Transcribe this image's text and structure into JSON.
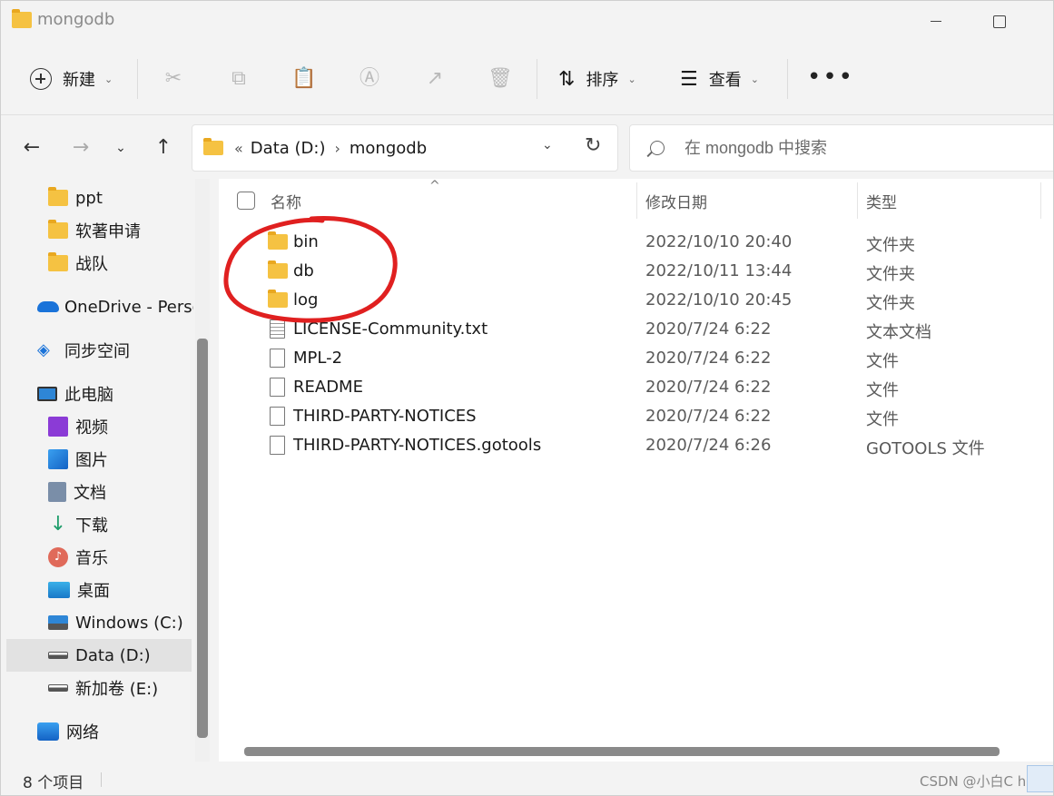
{
  "window": {
    "title": "mongodb"
  },
  "toolbar": {
    "new_label": "新建",
    "sort_label": "排序",
    "view_label": "查看",
    "more_label": "•••"
  },
  "address": {
    "overflow": "«",
    "segments": [
      "Data (D:)",
      "mongodb"
    ]
  },
  "search": {
    "placeholder": "在 mongodb 中搜索"
  },
  "sidebar": {
    "items": [
      {
        "label": "ppt",
        "icon": "folder-icon"
      },
      {
        "label": "软著申请",
        "icon": "folder-icon"
      },
      {
        "label": "战队",
        "icon": "folder-icon"
      },
      {
        "label": "OneDrive - Perso",
        "icon": "onedrive-icon"
      },
      {
        "label": "同步空间",
        "icon": "sync-space-icon"
      },
      {
        "label": "此电脑",
        "icon": "this-pc-icon"
      },
      {
        "label": "视频",
        "icon": "videos-icon"
      },
      {
        "label": "图片",
        "icon": "pictures-icon"
      },
      {
        "label": "文档",
        "icon": "documents-icon"
      },
      {
        "label": "下载",
        "icon": "downloads-icon"
      },
      {
        "label": "音乐",
        "icon": "music-icon"
      },
      {
        "label": "桌面",
        "icon": "desktop-icon"
      },
      {
        "label": "Windows (C:)",
        "icon": "drive-c-icon"
      },
      {
        "label": "Data (D:)",
        "icon": "drive-icon",
        "selected": true
      },
      {
        "label": "新加卷 (E:)",
        "icon": "drive-icon"
      },
      {
        "label": "网络",
        "icon": "network-icon"
      }
    ]
  },
  "columns": {
    "name": "名称",
    "date": "修改日期",
    "type": "类型"
  },
  "files": [
    {
      "name": "bin",
      "date": "2022/10/10 20:40",
      "type": "文件夹",
      "kind": "folder"
    },
    {
      "name": "db",
      "date": "2022/10/11 13:44",
      "type": "文件夹",
      "kind": "folder"
    },
    {
      "name": "log",
      "date": "2022/10/10 20:45",
      "type": "文件夹",
      "kind": "folder"
    },
    {
      "name": "LICENSE-Community.txt",
      "date": "2020/7/24 6:22",
      "type": "文本文档",
      "kind": "text"
    },
    {
      "name": "MPL-2",
      "date": "2020/7/24 6:22",
      "type": "文件",
      "kind": "file"
    },
    {
      "name": "README",
      "date": "2020/7/24 6:22",
      "type": "文件",
      "kind": "file"
    },
    {
      "name": "THIRD-PARTY-NOTICES",
      "date": "2020/7/24 6:22",
      "type": "文件",
      "kind": "file"
    },
    {
      "name": "THIRD-PARTY-NOTICES.gotools",
      "date": "2020/7/24 6:26",
      "type": "GOTOOLS 文件",
      "kind": "file"
    }
  ],
  "status": {
    "count": "8 个项目",
    "watermark": "CSDN @小白C hi"
  },
  "colors": {
    "folder": "#f5c242",
    "annotation": "#e02020",
    "selected": "#e2e2e2"
  }
}
